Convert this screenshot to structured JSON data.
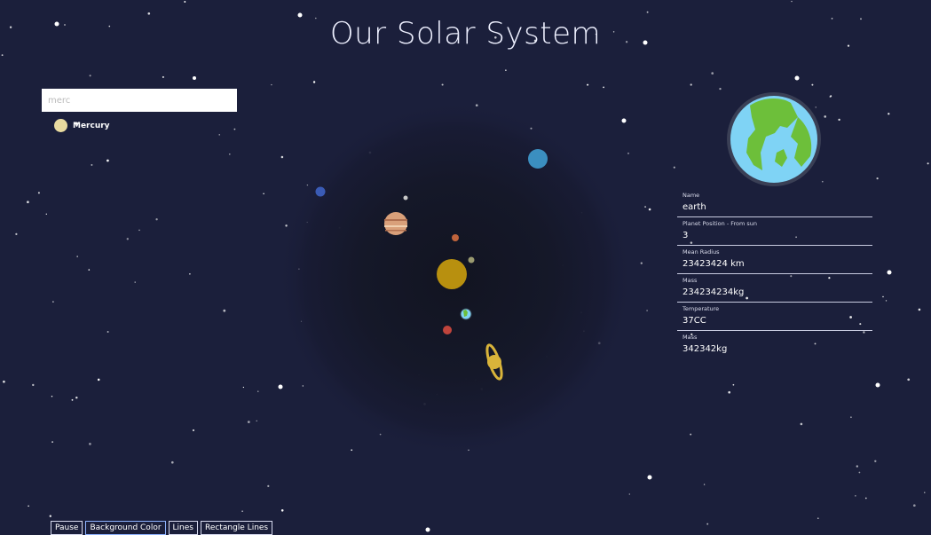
{
  "header": {
    "title": "Our Solar System"
  },
  "search": {
    "value": "merc",
    "placeholder": "merc",
    "results": [
      {
        "label": "Mercury",
        "color": "#e9dba0"
      }
    ]
  },
  "selected_planet": {
    "image": "earth-icon",
    "fields": [
      {
        "label": "Name",
        "value": "earth"
      },
      {
        "label": "Planet Position - From sun",
        "value": "3"
      },
      {
        "label": "Mean Radius",
        "value": "23423424 km"
      },
      {
        "label": "Mass",
        "value": "234234234kg"
      },
      {
        "label": "Temperature",
        "value": "37CC"
      },
      {
        "label": "Mass",
        "value": "342342kg"
      }
    ]
  },
  "controls": {
    "pause_label": "Pause",
    "background_color_label": "Background Color",
    "lines_label": "Lines",
    "rectangle_lines_label": "Rectangle Lines"
  },
  "colors": {
    "background": "#1b1f3b",
    "sun": "#b8900f",
    "earth_ocean": "#7fd3f5",
    "earth_land": "#6dbf3a",
    "uranus": "#3b8fc0",
    "neptune": "#3a5bb5",
    "jupiter": "#d9a07a",
    "saturn": "#d9b43a",
    "mars": "#c0443c",
    "venus": "#c0643c"
  }
}
